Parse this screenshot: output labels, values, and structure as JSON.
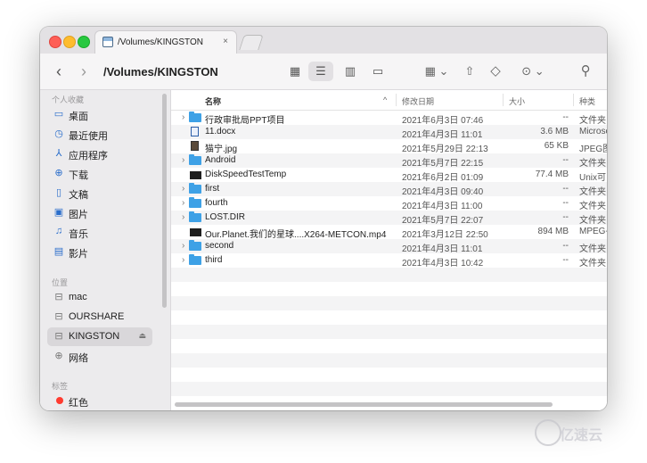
{
  "tab": {
    "title": "/Volumes/KINGSTON",
    "close": "×"
  },
  "toolbar": {
    "back": "‹",
    "forward": "›",
    "path_title": "/Volumes/KINGSTON",
    "view_icons": "▦",
    "view_list": "☰",
    "view_columns": "▥",
    "view_gallery": "▭",
    "group": "▦ ⌄",
    "share": "⇧",
    "tag": "◇",
    "more": "⊙ ⌄",
    "search": "⚲"
  },
  "sidebar": {
    "sections": [
      {
        "title": "个人收藏"
      },
      {
        "title": "位置"
      },
      {
        "title": "标签"
      }
    ],
    "favorites": [
      {
        "label": "桌面",
        "icon": "▭"
      },
      {
        "label": "最近使用",
        "icon": "◷"
      },
      {
        "label": "应用程序",
        "icon": "⅄"
      },
      {
        "label": "下载",
        "icon": "⊕"
      },
      {
        "label": "文稿",
        "icon": "▯"
      },
      {
        "label": "图片",
        "icon": "▣"
      },
      {
        "label": "音乐",
        "icon": "♫"
      },
      {
        "label": "影片",
        "icon": "▤"
      }
    ],
    "locations": [
      {
        "label": "mac",
        "icon": "⊟"
      },
      {
        "label": "OURSHARE",
        "icon": "⊟"
      },
      {
        "label": "KINGSTON",
        "icon": "⊟",
        "eject": "⏏",
        "selected": true
      },
      {
        "label": "网络",
        "icon": "⊕"
      }
    ],
    "tags": [
      {
        "label": "红色",
        "color": "#ff3b30"
      }
    ]
  },
  "columns": {
    "name": "名称",
    "sort_arrow": "^",
    "date": "修改日期",
    "size": "大小",
    "kind": "种类"
  },
  "files": [
    {
      "name": "行政审批局PPT项目",
      "date": "2021年6月3日 07:46",
      "size": "--",
      "kind": "文件夹",
      "type": "folder"
    },
    {
      "name": "11.docx",
      "date": "2021年4月3日 11:01",
      "size": "3.6 MB",
      "kind": "Microso",
      "type": "doc"
    },
    {
      "name": "猫宁.jpg",
      "date": "2021年5月29日 22:13",
      "size": "65 KB",
      "kind": "JPEG图",
      "type": "image"
    },
    {
      "name": "Android",
      "date": "2021年5月7日 22:15",
      "size": "--",
      "kind": "文件夹",
      "type": "folder"
    },
    {
      "name": "DiskSpeedTestTemp",
      "date": "2021年6月2日 01:09",
      "size": "77.4 MB",
      "kind": "Unix可",
      "type": "binary"
    },
    {
      "name": "first",
      "date": "2021年4月3日 09:40",
      "size": "--",
      "kind": "文件夹",
      "type": "folder"
    },
    {
      "name": "fourth",
      "date": "2021年4月3日 11:00",
      "size": "--",
      "kind": "文件夹",
      "type": "folder"
    },
    {
      "name": "LOST.DIR",
      "date": "2021年5月7日 22:07",
      "size": "--",
      "kind": "文件夹",
      "type": "folder"
    },
    {
      "name": "Our.Planet.我们的星球....X264-METCON.mp4",
      "date": "2021年3月12日 22:50",
      "size": "894 MB",
      "kind": "MPEG-",
      "type": "binary"
    },
    {
      "name": "second",
      "date": "2021年4月3日 11:01",
      "size": "--",
      "kind": "文件夹",
      "type": "folder"
    },
    {
      "name": "third",
      "date": "2021年4月3日 10:42",
      "size": "--",
      "kind": "文件夹",
      "type": "folder"
    }
  ],
  "disclosure": "›",
  "colors": {
    "folder": "#3ea1e6",
    "accent": "#2b6ecb",
    "red_tag": "#ff3b30"
  },
  "watermark": "亿速云"
}
